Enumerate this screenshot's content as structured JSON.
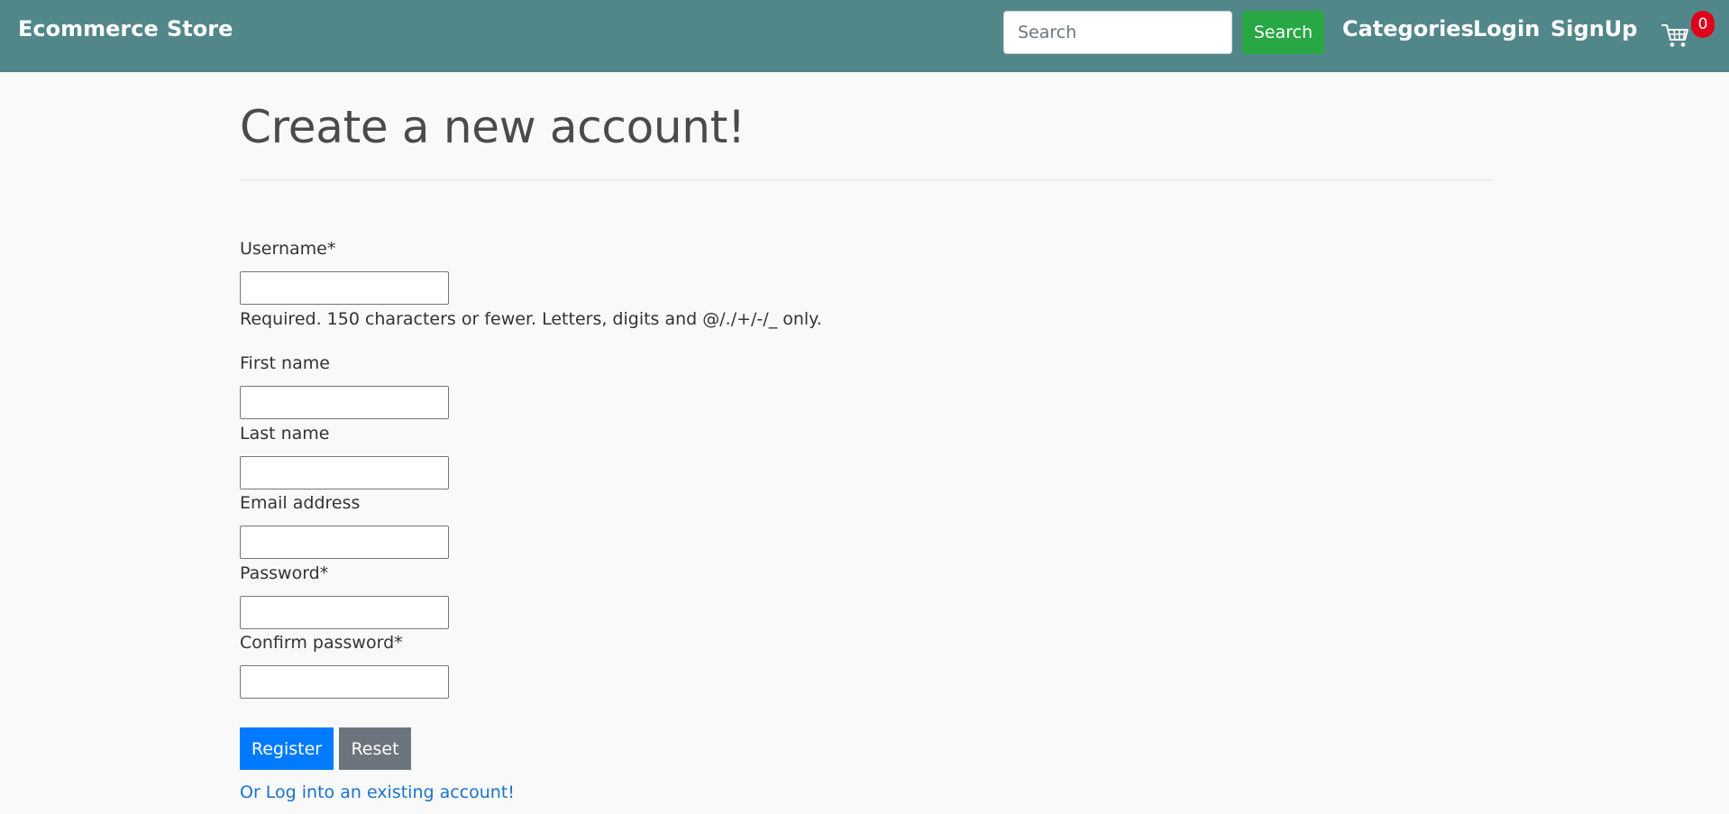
{
  "navbar": {
    "brand": "Ecommerce",
    "store": "Store",
    "search": {
      "placeholder": "Search",
      "value": "",
      "button_label": "Search"
    },
    "links": {
      "categories": "Categories",
      "login": "Login",
      "signup": "SignUp"
    },
    "cart": {
      "icon": "cart-icon",
      "count": "0"
    },
    "colors": {
      "background": "#52878a",
      "search_button": "#28a745",
      "badge": "#e0001a"
    }
  },
  "page": {
    "title": "Create a new account!"
  },
  "form": {
    "username": {
      "label": "Username*",
      "value": "",
      "help": "Required. 150 characters or fewer. Letters, digits and @/./+/-/_ only."
    },
    "first_name": {
      "label": "First name",
      "value": ""
    },
    "last_name": {
      "label": "Last name",
      "value": ""
    },
    "email": {
      "label": "Email address",
      "value": ""
    },
    "password": {
      "label": "Password*",
      "value": ""
    },
    "confirm_password": {
      "label": "Confirm password*",
      "value": ""
    },
    "register_label": "Register",
    "reset_label": "Reset",
    "login_link": "Or Log into an existing account!",
    "colors": {
      "register": "#007bff",
      "reset": "#6c757d",
      "link": "#1a73c7"
    }
  }
}
